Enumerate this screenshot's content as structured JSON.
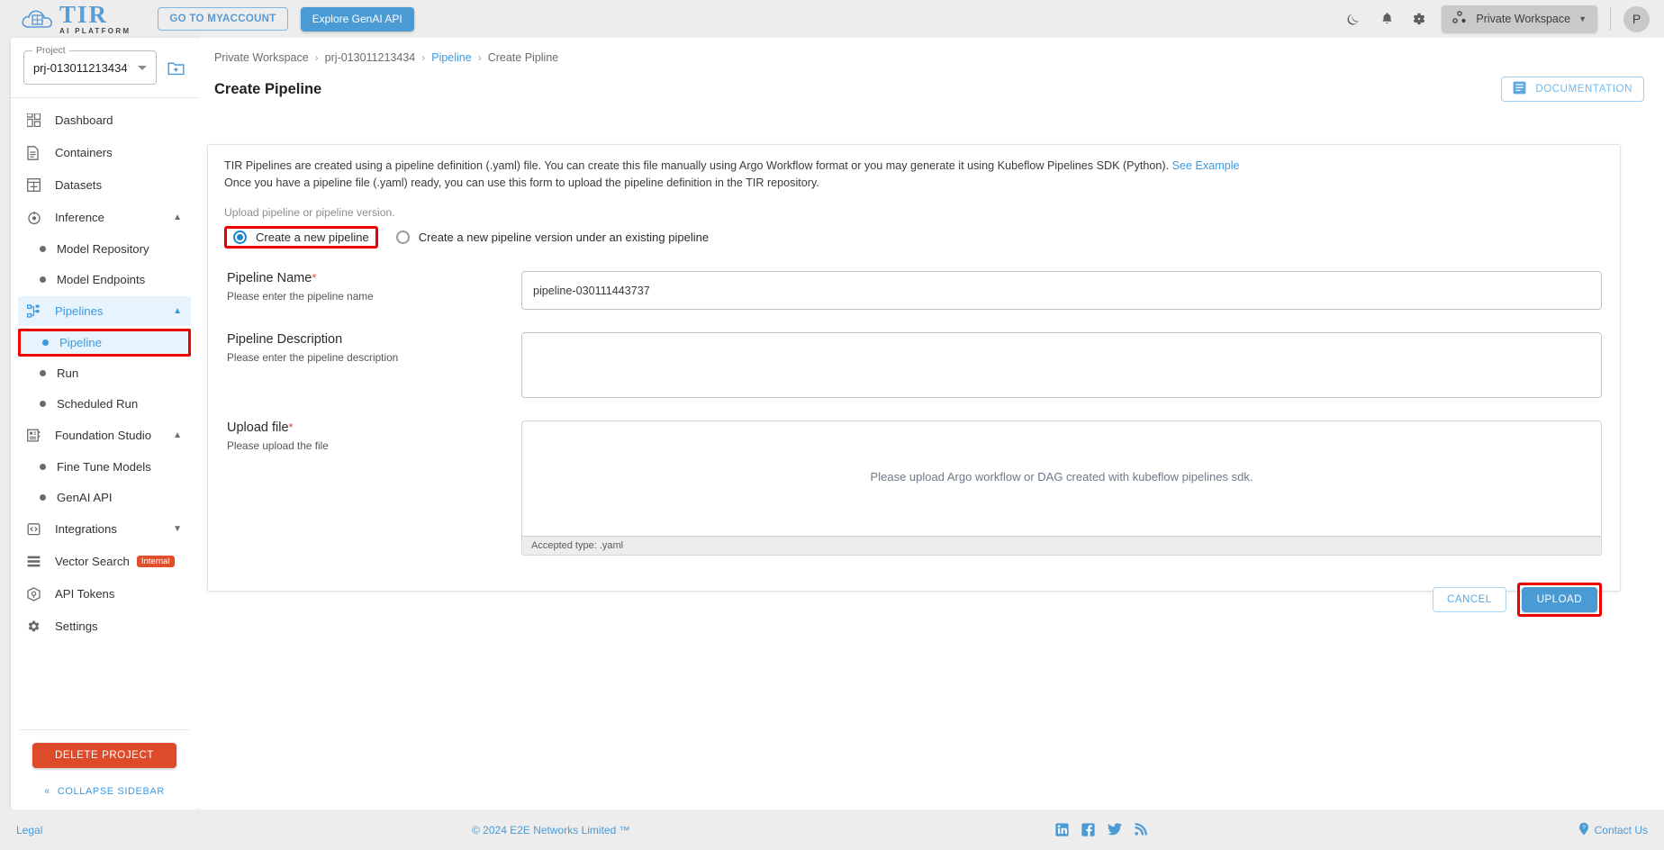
{
  "header": {
    "logo_title": "TIR",
    "logo_subtitle": "AI PLATFORM",
    "my_account_label": "GO TO MYACCOUNT",
    "explore_label": "Explore GenAI API",
    "workspace_label": "Private Workspace",
    "avatar_initial": "P",
    "icons": {
      "dark_mode": "moon-icon",
      "notifications": "bell-icon",
      "settings": "gear-icon",
      "workspace": "workspace-nodes-icon"
    }
  },
  "sidebar": {
    "project_label": "Project",
    "project_value": "prj-013011213434",
    "items": [
      {
        "label": "Dashboard",
        "icon": "dashboard-icon",
        "type": "item"
      },
      {
        "label": "Containers",
        "icon": "document-icon",
        "type": "item"
      },
      {
        "label": "Datasets",
        "icon": "grid-icon",
        "type": "item"
      },
      {
        "label": "Inference",
        "icon": "inference-icon",
        "type": "group",
        "expanded": true
      },
      {
        "label": "Model Repository",
        "type": "sub"
      },
      {
        "label": "Model Endpoints",
        "type": "sub"
      },
      {
        "label": "Pipelines",
        "icon": "pipelines-icon",
        "type": "group",
        "expanded": true,
        "active": true
      },
      {
        "label": "Pipeline",
        "type": "sub",
        "active": true,
        "highlighted": true
      },
      {
        "label": "Run",
        "type": "sub"
      },
      {
        "label": "Scheduled Run",
        "type": "sub"
      },
      {
        "label": "Foundation Studio",
        "icon": "studio-icon",
        "type": "group",
        "expanded": true
      },
      {
        "label": "Fine Tune Models",
        "type": "sub"
      },
      {
        "label": "GenAI API",
        "type": "sub"
      },
      {
        "label": "Integrations",
        "icon": "code-icon",
        "type": "group",
        "expanded": false
      },
      {
        "label": "Vector Search",
        "icon": "list-icon",
        "type": "item",
        "badge": "Internal"
      },
      {
        "label": "API Tokens",
        "icon": "token-icon",
        "type": "item"
      },
      {
        "label": "Settings",
        "icon": "gear-icon",
        "type": "item"
      }
    ],
    "delete_project_label": "DELETE PROJECT",
    "collapse_label": "COLLAPSE SIDEBAR"
  },
  "breadcrumb": {
    "workspace": "Private Workspace",
    "project": "prj-013011213434",
    "section": "Pipeline",
    "current": "Create Pipline"
  },
  "page": {
    "title": "Create Pipeline",
    "documentation_label": "DOCUMENTATION"
  },
  "form": {
    "desc_line1_pre": "TIR Pipelines are created using a pipeline definition (.yaml) file. You can create this file manually using Argo Workflow format or you may generate it using Kubeflow Pipelines SDK (Python).",
    "desc_link": "See Example",
    "desc_line2": "Once you have a pipeline file (.yaml) ready, you can use this form to upload the pipeline definition in the TIR repository.",
    "upload_hint": "Upload pipeline or pipeline version.",
    "radio_new_pipeline": "Create a new pipeline",
    "radio_new_version": "Create a new pipeline version under an existing pipeline",
    "pipeline_name_label": "Pipeline Name",
    "pipeline_name_required": "*",
    "pipeline_name_sub": "Please enter the pipeline name",
    "pipeline_name_value": "pipeline-030111443737",
    "pipeline_desc_label": "Pipeline Description",
    "pipeline_desc_sub": "Please enter the pipeline description",
    "pipeline_desc_value": "",
    "upload_file_label": "Upload file",
    "upload_file_required": "*",
    "upload_file_sub": "Please upload the file",
    "dropzone_text": "Please upload Argo workflow or DAG created with kubeflow pipelines sdk.",
    "accepted_type": "Accepted type: .yaml",
    "cancel_label": "CANCEL",
    "upload_label": "UPLOAD"
  },
  "footer": {
    "legal": "Legal",
    "copyright": "© 2024 E2E Networks Limited ™",
    "contact": "Contact Us",
    "socials": [
      "linkedin-icon",
      "facebook-icon",
      "twitter-icon",
      "rss-icon"
    ]
  },
  "colors": {
    "accent": "#4a9ad4",
    "danger": "#dd4b2b",
    "highlight_outline": "#ef0000",
    "active_bg": "#e8f4fd"
  }
}
